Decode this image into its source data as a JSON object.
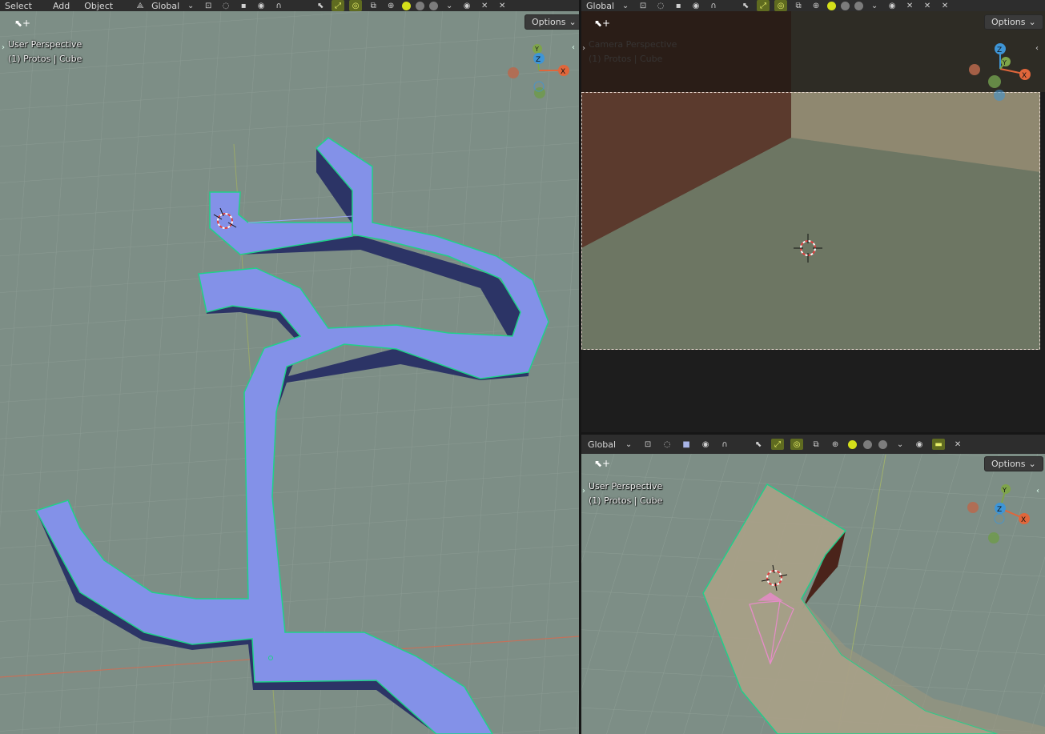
{
  "left_viewport": {
    "menu": [
      "Select",
      "Add",
      "Object"
    ],
    "orientation": "Global",
    "options_label": "Options",
    "view_name": "User Perspective",
    "object_info": "(1) Protos | Cube",
    "gizmo": {
      "x": "X",
      "y": "Y",
      "z": "Z"
    }
  },
  "camera_viewport": {
    "orientation": "Global",
    "options_label": "Options",
    "view_name": "Camera Perspective",
    "object_info": "(1) Protos | Cube",
    "gizmo": {
      "x": "X",
      "y": "Y",
      "z": "Z"
    }
  },
  "bottom_viewport": {
    "orientation": "Global",
    "options_label": "Options",
    "view_name": "User Perspective",
    "object_info": "(1) Protos | Cube",
    "gizmo": {
      "x": "X",
      "y": "Y",
      "z": "Z"
    }
  },
  "colors": {
    "grid_bg": "#7f8f87",
    "mesh_top": "#8391e8",
    "mesh_side": "#2c3466",
    "mesh_outline": "#1fd18a",
    "x_axis": "#e0663b",
    "y_axis": "#7ea44a",
    "z_axis": "#3e95d6"
  }
}
